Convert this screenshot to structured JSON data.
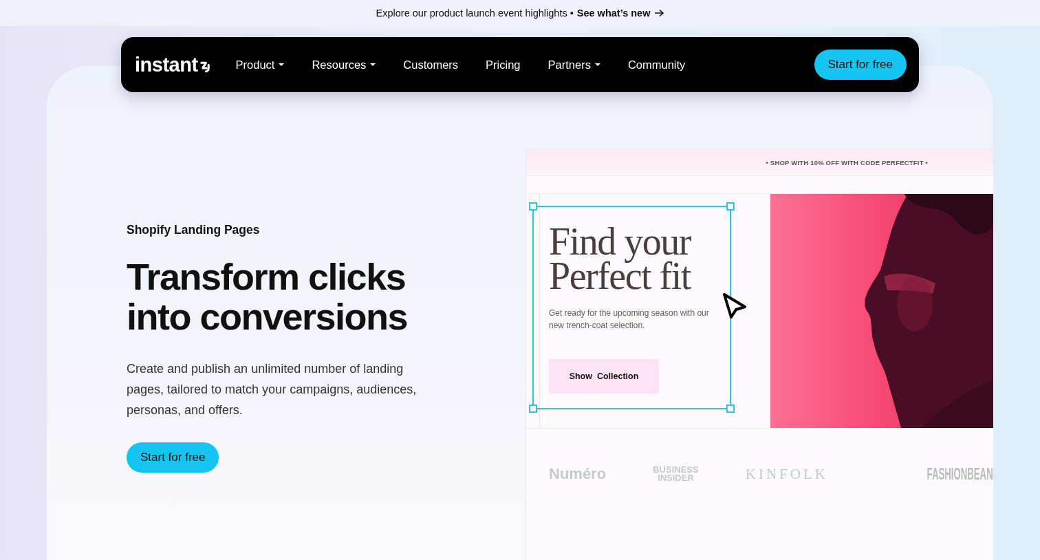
{
  "announcement": {
    "text": "Explore our product launch event highlights •",
    "link": "See what’s new"
  },
  "nav": {
    "logo": "instant",
    "items": [
      {
        "label": "Product",
        "has_menu": true
      },
      {
        "label": "Resources",
        "has_menu": true
      },
      {
        "label": "Customers",
        "has_menu": false
      },
      {
        "label": "Pricing",
        "has_menu": false
      },
      {
        "label": "Partners",
        "has_menu": true
      },
      {
        "label": "Community",
        "has_menu": false
      }
    ],
    "cta": "Start for free"
  },
  "hero": {
    "eyebrow": "Shopify Landing Pages",
    "title": "Transform clicks into conversions",
    "description": "Create and publish an unlimited number of landing pages, tailored to match your campaigns, audiences, personas, and offers.",
    "cta": "Start for free"
  },
  "preview": {
    "promo": "• SHOP WITH 10% OFF WITH CODE PERFECTFIT •",
    "headline": "Find your Perfect fit",
    "subtext": "Get ready for the upcoming season with our new trench-coat selection.",
    "button": "Show  Collection",
    "logos": [
      {
        "text": "Numéro",
        "kind": "sans"
      },
      {
        "text": "BUSINESS INSIDER",
        "kind": "stacked"
      },
      {
        "text": "KINFOLK",
        "kind": "serif"
      },
      {
        "text": "FASHIONBEAN",
        "kind": "condensed"
      }
    ]
  }
}
